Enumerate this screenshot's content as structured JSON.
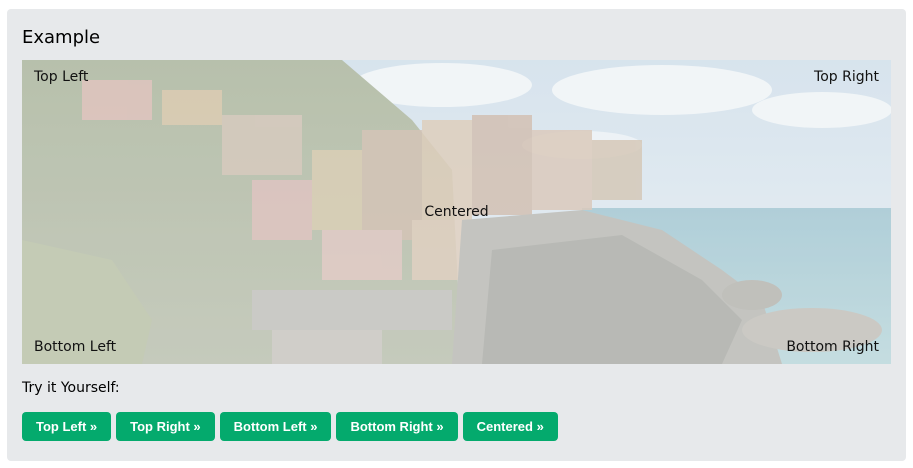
{
  "example": {
    "title": "Example",
    "image": {
      "alt": "Cinque Terre",
      "labels": {
        "top_left": "Top Left",
        "top_right": "Top Right",
        "bottom_left": "Bottom Left",
        "bottom_right": "Bottom Right",
        "centered": "Centered"
      }
    },
    "try_label": "Try it Yourself:",
    "buttons": [
      {
        "label": "Top Left »"
      },
      {
        "label": "Top Right »"
      },
      {
        "label": "Bottom Left »"
      },
      {
        "label": "Bottom Right »"
      },
      {
        "label": "Centered »"
      }
    ]
  },
  "colors": {
    "panel_bg": "#e7e9eb",
    "button_bg": "#04aa6d",
    "button_text": "#ffffff"
  }
}
